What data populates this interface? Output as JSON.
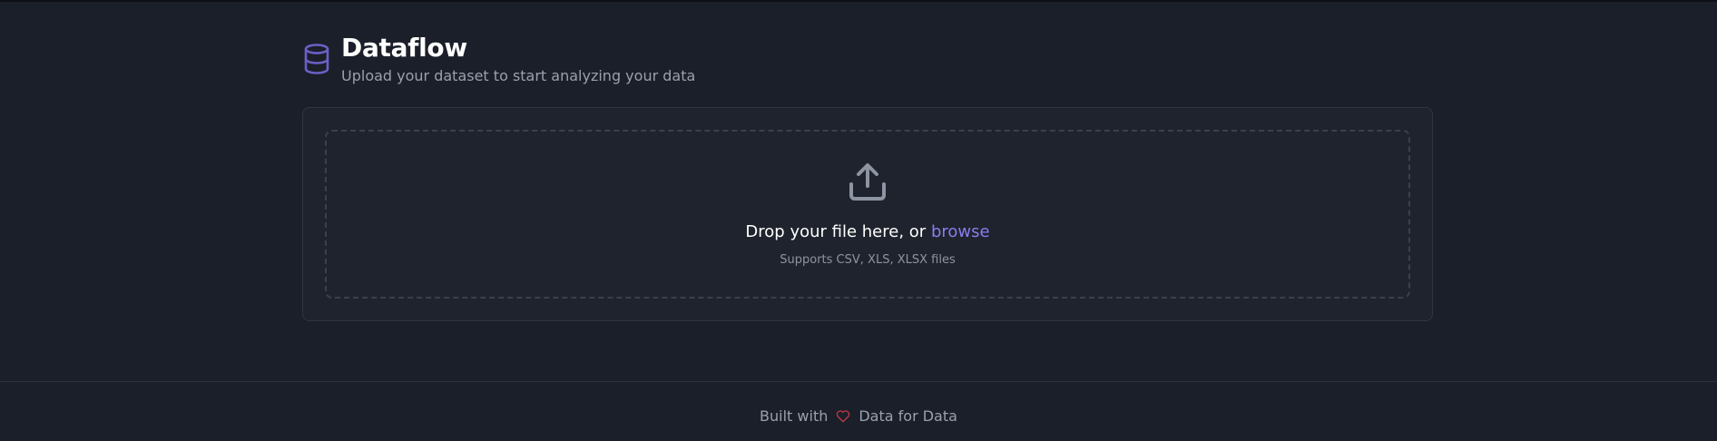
{
  "app": {
    "title": "Dataflow",
    "subtitle": "Upload your dataset to start analyzing your data"
  },
  "upload": {
    "drop_text": "Drop your file here, or",
    "browse_label": "browse",
    "supports_text": "Supports CSV, XLS, XLSX files"
  },
  "footer": {
    "built_with": "Built with",
    "by_text": "Data for Data"
  },
  "icons": {
    "logo": "database-icon",
    "upload": "upload-icon",
    "heart": "heart-icon"
  },
  "colors": {
    "background": "#1b1f29",
    "card": "#1f232d",
    "accent": "#8a7cf0",
    "logo": "#6c5fc7",
    "heart": "#c0394a"
  }
}
